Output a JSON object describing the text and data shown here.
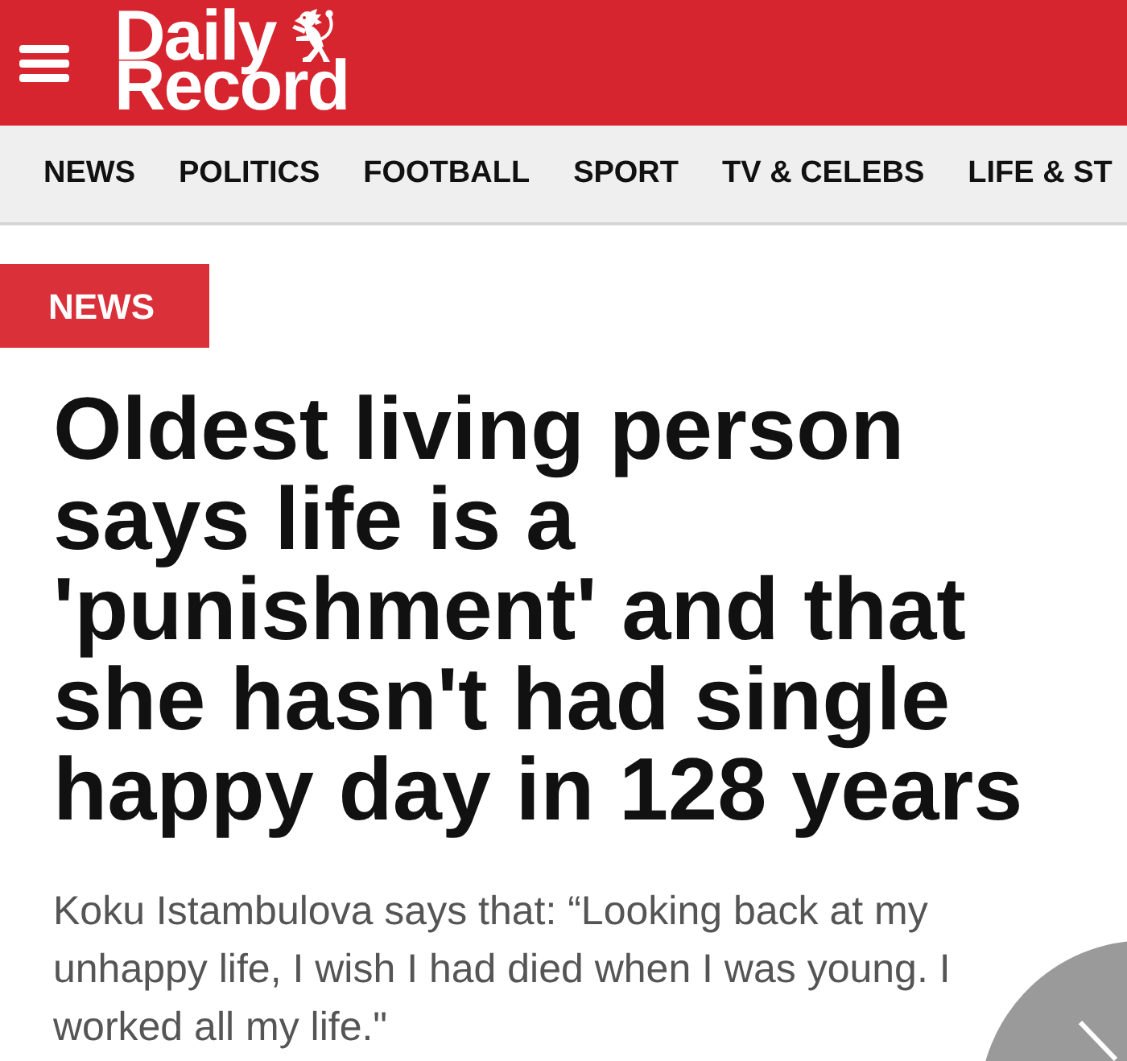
{
  "header": {
    "logo": {
      "line_1": "Daily",
      "line_2": "Record"
    }
  },
  "nav": {
    "items": [
      "NEWS",
      "POLITICS",
      "FOOTBALL",
      "SPORT",
      "TV & CELEBS",
      "LIFE & ST"
    ]
  },
  "article": {
    "section_badge": "NEWS",
    "headline": "Oldest living person says life is a 'punishment' and that she hasn't had single happy day in 128 years",
    "standfirst": "Koku Istambulova says that: “Looking back at my unhappy life, I wish I had died when I was young. I worked all my life.\""
  }
}
